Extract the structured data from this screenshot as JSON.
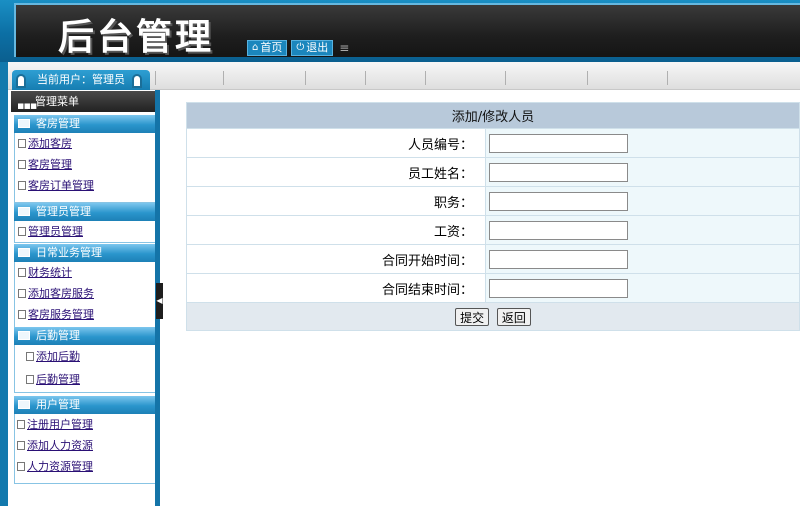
{
  "header": {
    "title": "后台管理",
    "nav": [
      {
        "label": "首页",
        "icon": "home-icon"
      },
      {
        "label": "退出",
        "icon": "power-icon"
      }
    ]
  },
  "userbar": {
    "current_user": "当前用户：管理员"
  },
  "sidebar": {
    "menu_title": "管理菜单",
    "groups": [
      {
        "title": "客房管理",
        "items": [
          "添加客房",
          "客房管理",
          "客房订单管理"
        ]
      },
      {
        "title": "管理员管理",
        "items": [
          "管理员管理"
        ]
      },
      {
        "title": "日常业务管理",
        "items": [
          "财务统计",
          "添加客房服务",
          "客房服务管理"
        ]
      },
      {
        "title": "后勤管理",
        "items": [
          "添加后勤",
          "后勤管理"
        ]
      },
      {
        "title": "用户管理",
        "items": [
          "注册用户管理",
          "添加人力资源",
          "人力资源管理"
        ]
      }
    ]
  },
  "form": {
    "title": "添加/修改人员",
    "fields": [
      {
        "label": "人员编号：",
        "value": ""
      },
      {
        "label": "员工姓名：",
        "value": ""
      },
      {
        "label": "职务：",
        "value": ""
      },
      {
        "label": "工资：",
        "value": ""
      },
      {
        "label": "合同开始时间：",
        "value": ""
      },
      {
        "label": "合同结束时间：",
        "value": ""
      }
    ],
    "submit_label": "提交",
    "back_label": "返回"
  },
  "colors": {
    "header_blue": "#0c6fa4",
    "banner_dark": "#1e1e1e",
    "form_title_bg": "#b8c9da",
    "link": "#2a1075"
  }
}
